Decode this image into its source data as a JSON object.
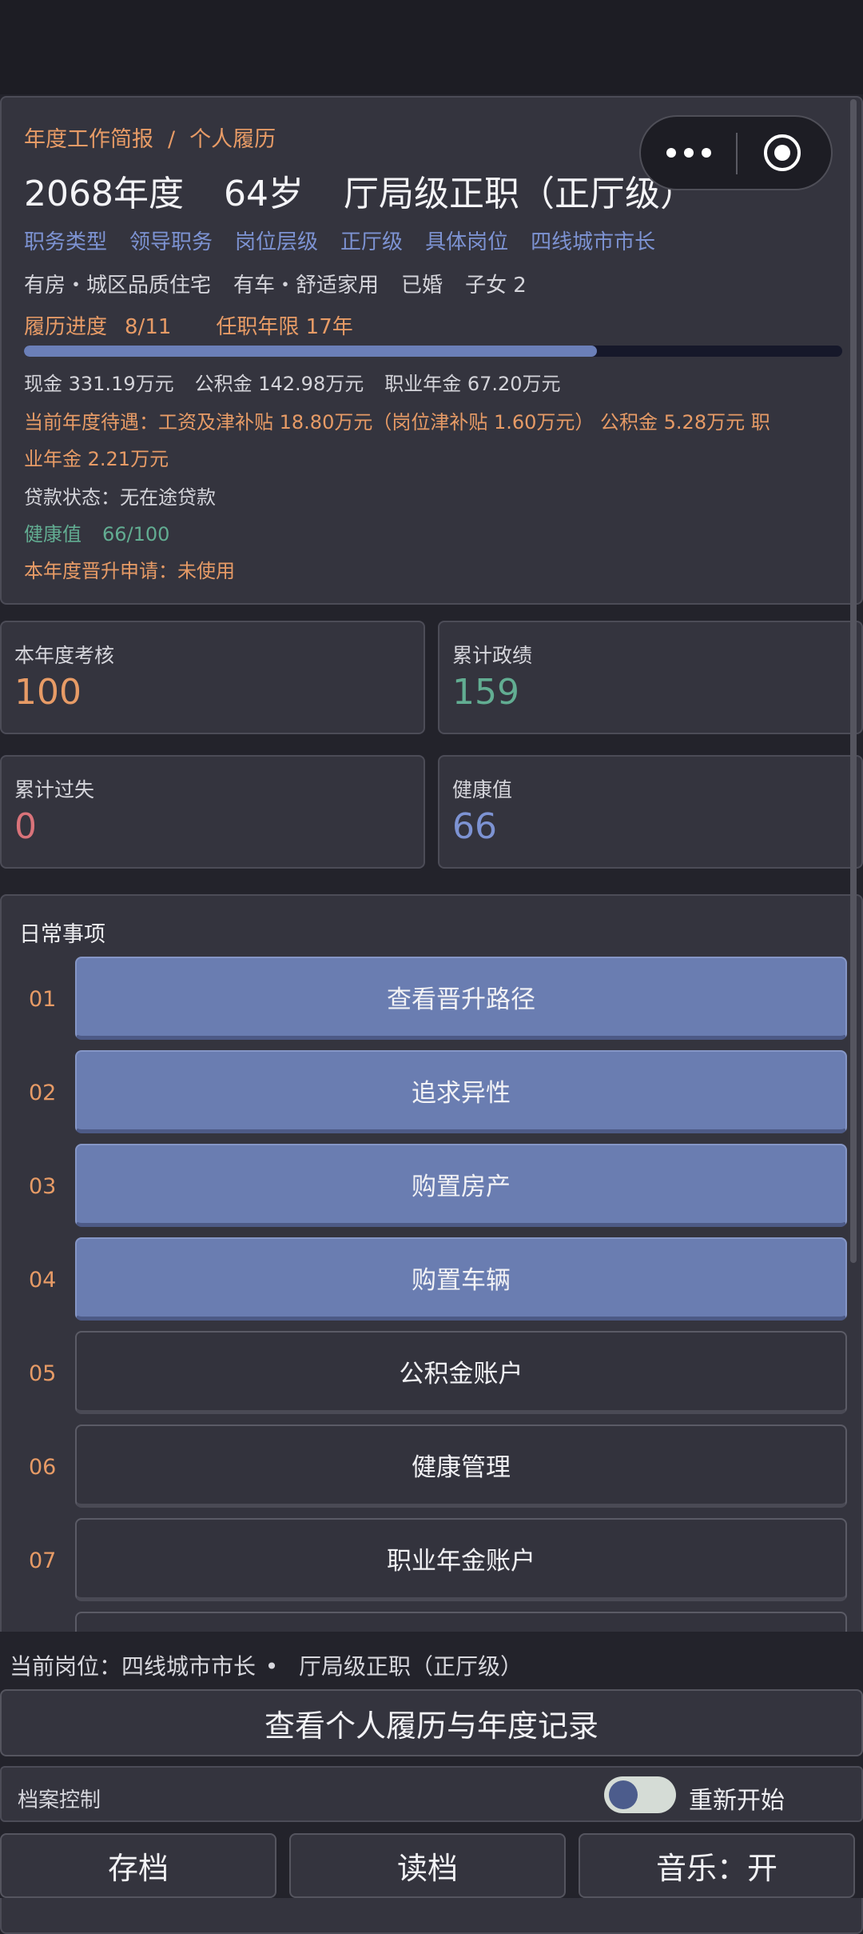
{
  "profile": {
    "breadcrumb": [
      "年度工作简报",
      "个人履历"
    ],
    "breadcrumb_sep": "/",
    "year": "2068年度",
    "age": "64岁",
    "rank": "厅局级正职（正厅级）",
    "job_meta": [
      "职务类型",
      "领导职务",
      "岗位层级",
      "正厅级",
      "具体岗位",
      "四线城市市长"
    ],
    "life": [
      "有房・城区品质住宅",
      "有车・舒适家用",
      "已婚",
      "子女 2"
    ],
    "progress_label": "履历进度",
    "progress_value": "8/11",
    "tenure": "任职年限 17年",
    "progress_fraction": 0.7,
    "assets": [
      "现金 331.19万元",
      "公积金 142.98万元",
      "职业年金 67.20万元"
    ],
    "treatment_line1": "当前年度待遇：工资及津补贴 18.80万元（岗位津补贴 1.60万元）    公积金 5.28万元    职",
    "treatment_line2": "业年金 2.21万元",
    "loan": "贷款状态：无在途贷款",
    "health_label": "健康值",
    "health_value": "66/100",
    "promotion": "本年度晋升申请：未使用"
  },
  "stats": [
    {
      "label": "本年度考核",
      "value": "100",
      "color": "#e79b66"
    },
    {
      "label": "累计政绩",
      "value": "159",
      "color": "#62ad92"
    },
    {
      "label": "累计过失",
      "value": "0",
      "color": "#d9737a"
    },
    {
      "label": "健康值",
      "value": "66",
      "color": "#7d93d3"
    }
  ],
  "daily": {
    "title": "日常事项",
    "items": [
      {
        "num": "01",
        "label": "查看晋升路径",
        "active": true
      },
      {
        "num": "02",
        "label": "追求异性",
        "active": true
      },
      {
        "num": "03",
        "label": "购置房产",
        "active": true
      },
      {
        "num": "04",
        "label": "购置车辆",
        "active": true
      },
      {
        "num": "05",
        "label": "公积金账户",
        "active": false
      },
      {
        "num": "06",
        "label": "健康管理",
        "active": false
      },
      {
        "num": "07",
        "label": "职业年金账户",
        "active": false
      }
    ]
  },
  "footer": {
    "current_post": "当前岗位：四线城市市长",
    "dot": "•",
    "current_rank": "厅局级正职（正厅级）",
    "view_record": "查看个人履历与年度记录",
    "archive_label": "档案控制",
    "restart_label": "重新开始",
    "save": "存档",
    "load": "读档",
    "music": "音乐：开"
  }
}
